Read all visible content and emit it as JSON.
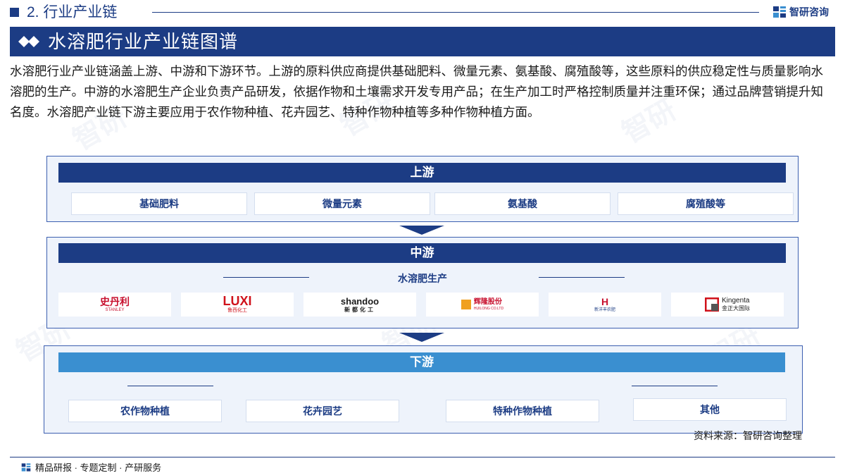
{
  "header": {
    "section_title": "2. 行业产业链",
    "brand_name": "智研咨询"
  },
  "title": "水溶肥行业产业链图谱",
  "intro": "水溶肥行业产业链涵盖上游、中游和下游环节。上游的原料供应商提供基础肥料、微量元素、氨基酸、腐殖酸等，这些原料的供应稳定性与质量影响水溶肥的生产。中游的水溶肥生产企业负责产品研发，依据作物和土壤需求开发专用产品；在生产加工时严格控制质量并注重环保；通过品牌营销提升知名度。水溶肥产业链下游主要应用于农作物种植、花卉园艺、特种作物种植等多种作物种植方面。",
  "upstream": {
    "label": "上游",
    "items": [
      "基础肥料",
      "微量元素",
      "氨基酸",
      "腐殖酸等"
    ]
  },
  "midstream": {
    "label": "中游",
    "sub_label": "水溶肥生产",
    "companies": [
      {
        "name": "史丹利",
        "sub": "STANLEY",
        "color": "#c8102e"
      },
      {
        "name": "LUXI",
        "sub": "鲁西化工",
        "color": "#d0121b"
      },
      {
        "name": "shandoo",
        "sub": "新都化工",
        "color": "#1a1a1a"
      },
      {
        "name": "辉隆股份",
        "sub": "HUILONG CO.LTD",
        "color": "#c8102e"
      },
      {
        "name": "H",
        "sub": "新洋丰农肥",
        "color": "#c8102e"
      },
      {
        "name": "Kingenta",
        "sub": "金正大国际",
        "color": "#1a1a1a"
      }
    ]
  },
  "downstream": {
    "label": "下游",
    "items": [
      "农作物种植",
      "花卉园艺",
      "特种作物种植",
      "其他"
    ]
  },
  "source": "资料来源：智研咨询整理",
  "footer": "精品研报 · 专题定制 · 产研服务",
  "watermark": "智研",
  "colors": {
    "brand": "#1c3c84",
    "downstream_head": "#3a8fd0",
    "panel_bg": "#eef3fb"
  }
}
